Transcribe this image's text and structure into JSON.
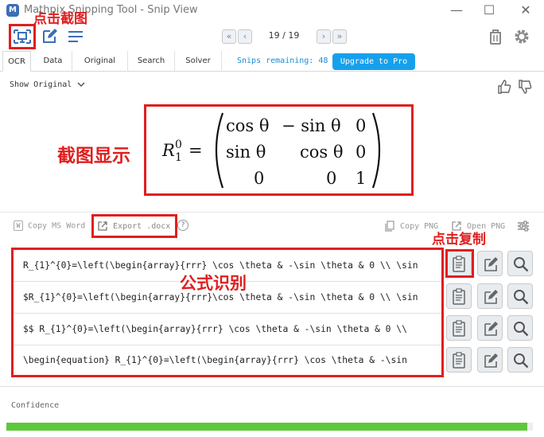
{
  "window": {
    "logo": "M",
    "title": "Mathpix Snipping Tool - Snip View",
    "minimize": "—",
    "maximize": "☐",
    "close": "✕"
  },
  "toolbar": {
    "pagination": {
      "counter": "19 / 19"
    }
  },
  "tabs": [
    "OCR",
    "Data",
    "Original",
    "Search",
    "Solver"
  ],
  "snips_remaining": "Snips remaining: 48",
  "upgrade_label": "Upgrade to Pro",
  "show_original": "Show Original",
  "formula": {
    "lhs": "R",
    "sup": "0",
    "sub": "1",
    "equals": "=",
    "matrix": [
      [
        "cos θ",
        "− sin θ",
        "0"
      ],
      [
        "sin θ",
        "cos θ",
        "0"
      ],
      [
        "0",
        "0",
        "1"
      ]
    ]
  },
  "export": {
    "copy_ms_word": "Copy MS Word",
    "export_docx": "Export .docx",
    "help": "?",
    "copy_png": "Copy PNG",
    "open_png": "Open PNG"
  },
  "results": [
    "R_{1}^{0}=\\left(\\begin{array}{rrr} \\cos \\theta & -\\sin \\theta & 0 \\\\ \\sin",
    "$R_{1}^{0}=\\left(\\begin{array}{rrr}\\cos \\theta & -\\sin \\theta & 0 \\\\ \\sin",
    "$$  R_{1}^{0}=\\left(\\begin{array}{rrr} \\cos \\theta & -\\sin \\theta & 0 \\\\",
    "\\begin{equation}  R_{1}^{0}=\\left(\\begin{array}{rrr} \\cos \\theta & -\\sin"
  ],
  "confidence": {
    "label": "Confidence",
    "value": 0.99,
    "color": "#5cc93a"
  },
  "annotations": {
    "snip": "点击截图",
    "display": "截图显示",
    "ocr": "公式识别",
    "copy": "点击复制"
  },
  "colors": {
    "accent": "#16a0ec",
    "annotation": "#e01f1f",
    "link": "#1b8bd0"
  }
}
